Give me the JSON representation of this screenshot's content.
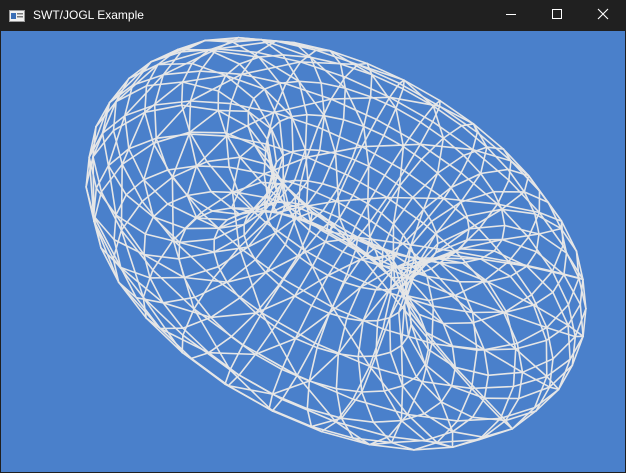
{
  "window": {
    "title": "SWT/JOGL Example",
    "controls": {
      "minimize_icon": "minimize-icon",
      "maximize_icon": "maximize-icon",
      "close_icon": "close-icon"
    }
  },
  "canvas": {
    "background_color": "#4a80cb",
    "wireframe_color": "#e6e6e6",
    "shape": "torus",
    "render_mode": "wireframe"
  }
}
